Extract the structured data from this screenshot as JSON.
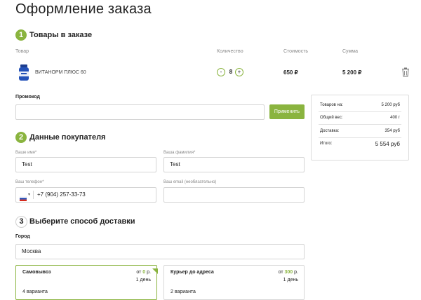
{
  "page": {
    "title": "Оформление заказа"
  },
  "steps": {
    "products": {
      "num": "1",
      "title": "Товары в заказе"
    },
    "buyer": {
      "num": "2",
      "title": "Данные покупателя"
    },
    "delivery": {
      "num": "3",
      "title": "Выберите способ доставки"
    }
  },
  "table": {
    "headers": {
      "product": "Товар",
      "quantity": "Количество",
      "price": "Стоимость",
      "sum": "Сумма"
    },
    "item": {
      "name": "ВИТАНОРМ ПЛЮС 60",
      "minus": "-",
      "qty": "8",
      "plus": "+",
      "price": "650 ₽",
      "sum": "5 200 ₽"
    }
  },
  "promo": {
    "label": "Промокод",
    "value": "",
    "button": "Применить"
  },
  "summary": {
    "rows": [
      {
        "key": "Товаров на:",
        "value": "5 200 руб"
      },
      {
        "key": "Общий вес:",
        "value": "400 г"
      },
      {
        "key": "Доставка:",
        "value": "354 руб"
      }
    ],
    "total_key": "Итого:",
    "total_value": "5 554 руб"
  },
  "buyer": {
    "first_name": {
      "label": "Ваше имя*",
      "value": "Test"
    },
    "last_name": {
      "label": "Ваша фамилия*",
      "value": "Test"
    },
    "phone": {
      "label": "Ваш телефон*",
      "value": "+7 (904) 257-33-73"
    },
    "email": {
      "label": "Ваш email (необязательно)",
      "value": ""
    }
  },
  "city": {
    "label": "Город",
    "value": "Москва"
  },
  "delivery_options": [
    {
      "name": "Самовывоз",
      "price_prefix": "от",
      "price": "0",
      "price_suffix": "р.",
      "days": "1 день",
      "variants": "4 варианта"
    },
    {
      "name": "Курьер до адреса",
      "price_prefix": "от",
      "price": "300",
      "price_suffix": "р.",
      "days": "1 день",
      "variants": "2 варианта"
    }
  ],
  "colors": {
    "accent": "#8ab43f",
    "border": "#d5d5d5",
    "text": "#222222"
  }
}
